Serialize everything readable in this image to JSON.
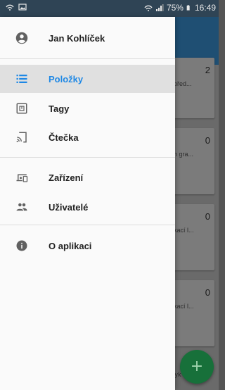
{
  "status_bar": {
    "battery_percent": "75%",
    "time": "16:49"
  },
  "drawer": {
    "user_name": "Jan Kohlíček",
    "items": [
      {
        "label": "Položky",
        "icon": "list-icon",
        "active": true
      },
      {
        "label": "Tagy",
        "icon": "nfc-tag-icon",
        "active": false
      },
      {
        "label": "Čtečka",
        "icon": "cast-reader-icon",
        "active": false
      },
      {
        "label": "Zařízení",
        "icon": "devices-icon",
        "active": false
      },
      {
        "label": "Uživatelé",
        "icon": "people-icon",
        "active": false
      },
      {
        "label": "O aplikaci",
        "icon": "info-icon",
        "active": false
      }
    ]
  },
  "background": {
    "cards": [
      {
        "count": "2",
        "snippet": "před..."
      },
      {
        "count": "0",
        "snippet": "n gra..."
      },
      {
        "count": "0",
        "snippet": "kací l..."
      },
      {
        "count": "0",
        "snippet": "kací l..."
      }
    ],
    "bottom_snippet": "vyk",
    "fab_label": "+"
  },
  "colors": {
    "accent": "#1e88e5",
    "app_bar": "#1f4f73",
    "fab": "#17703a"
  }
}
